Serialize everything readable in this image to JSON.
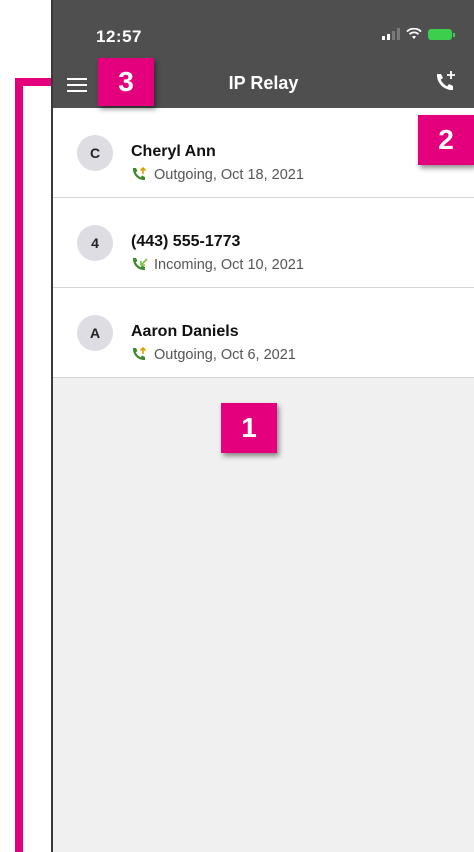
{
  "status_bar": {
    "time": "12:57"
  },
  "app_bar": {
    "title": "IP Relay"
  },
  "calls": [
    {
      "avatar": "C",
      "name": "Cheryl Ann",
      "detail": "Outgoing, Oct 18, 2021",
      "direction": "outgoing"
    },
    {
      "avatar": "4",
      "name": "(443) 555-1773",
      "detail": "Incoming, Oct 10, 2021",
      "direction": "incoming"
    },
    {
      "avatar": "A",
      "name": "Aaron Daniels",
      "detail": "Outgoing, Oct 6, 2021",
      "direction": "outgoing"
    }
  ],
  "callouts": {
    "one": "1",
    "two": "2",
    "three": "3"
  },
  "colors": {
    "accent": "#e4007c",
    "bar": "#4f4f4f",
    "call_icon": "#3f8a2f"
  }
}
